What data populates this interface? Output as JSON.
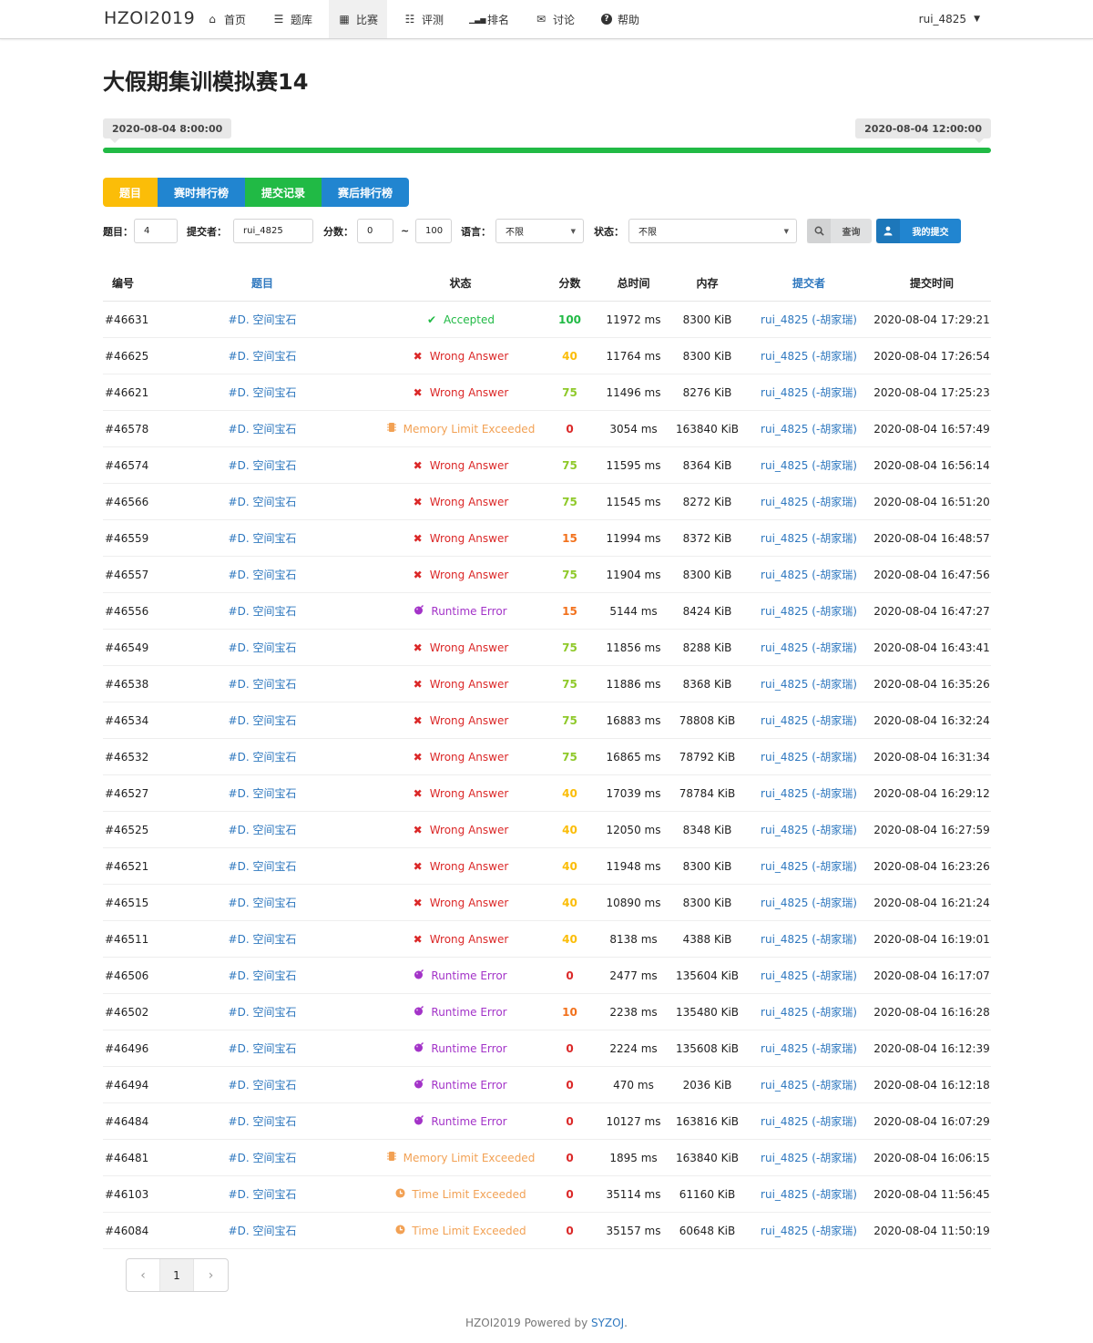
{
  "nav": {
    "brand": "HZOI2019",
    "items": [
      {
        "label": "首页",
        "icon": "home-icon"
      },
      {
        "label": "题库",
        "icon": "list-icon"
      },
      {
        "label": "比赛",
        "icon": "calendar-icon"
      },
      {
        "label": "评测",
        "icon": "tasks-icon"
      },
      {
        "label": "排名",
        "icon": "signal-icon"
      },
      {
        "label": "讨论",
        "icon": "comments-icon"
      },
      {
        "label": "帮助",
        "icon": "help-icon"
      }
    ],
    "active": "比赛",
    "user": "rui_4825"
  },
  "contest": {
    "title": "大假期集训模拟赛14",
    "start": "2020-08-04 8:00:00",
    "end": "2020-08-04 12:00:00",
    "progress": 1.0,
    "progress_color": "#21ba45"
  },
  "tabs": [
    {
      "label": "题目",
      "color": "#fbbd08"
    },
    {
      "label": "赛时排行榜",
      "color": "#2185d0"
    },
    {
      "label": "提交记录",
      "color": "#21ba45"
    },
    {
      "label": "赛后排行榜",
      "color": "#2185d0"
    }
  ],
  "filters": {
    "problem_label": "题目：",
    "problem_value": "4",
    "submitter_label": "提交者：",
    "submitter_value": "rui_4825",
    "score_label": "分数：",
    "score_min": "0",
    "score_sep": "~",
    "score_max": "100",
    "language_label": "语言：",
    "language_value": "不限",
    "status_label": "状态：",
    "status_value": "不限",
    "search_button": "查询",
    "mine_button": "我的提交"
  },
  "table": {
    "headers": [
      "编号",
      "题目",
      "状态",
      "分数",
      "总时间",
      "内存",
      "提交者",
      "提交时间"
    ],
    "rows": [
      {
        "id": "#46631",
        "problem": "#D. 空间宝石",
        "status": "Accepted",
        "score": "100",
        "time": "11972 ms",
        "memory": "8300 KiB",
        "submitter": "rui_4825 (-胡家瑞)",
        "submit_time": "2020-08-04 17:29:21"
      },
      {
        "id": "#46625",
        "problem": "#D. 空间宝石",
        "status": "Wrong Answer",
        "score": "40",
        "time": "11764 ms",
        "memory": "8300 KiB",
        "submitter": "rui_4825 (-胡家瑞)",
        "submit_time": "2020-08-04 17:26:54"
      },
      {
        "id": "#46621",
        "problem": "#D. 空间宝石",
        "status": "Wrong Answer",
        "score": "75",
        "time": "11496 ms",
        "memory": "8276 KiB",
        "submitter": "rui_4825 (-胡家瑞)",
        "submit_time": "2020-08-04 17:25:23"
      },
      {
        "id": "#46578",
        "problem": "#D. 空间宝石",
        "status": "Memory Limit Exceeded",
        "score": "0",
        "time": "3054 ms",
        "memory": "163840 KiB",
        "submitter": "rui_4825 (-胡家瑞)",
        "submit_time": "2020-08-04 16:57:49"
      },
      {
        "id": "#46574",
        "problem": "#D. 空间宝石",
        "status": "Wrong Answer",
        "score": "75",
        "time": "11595 ms",
        "memory": "8364 KiB",
        "submitter": "rui_4825 (-胡家瑞)",
        "submit_time": "2020-08-04 16:56:14"
      },
      {
        "id": "#46566",
        "problem": "#D. 空间宝石",
        "status": "Wrong Answer",
        "score": "75",
        "time": "11545 ms",
        "memory": "8272 KiB",
        "submitter": "rui_4825 (-胡家瑞)",
        "submit_time": "2020-08-04 16:51:20"
      },
      {
        "id": "#46559",
        "problem": "#D. 空间宝石",
        "status": "Wrong Answer",
        "score": "15",
        "time": "11994 ms",
        "memory": "8372 KiB",
        "submitter": "rui_4825 (-胡家瑞)",
        "submit_time": "2020-08-04 16:48:57"
      },
      {
        "id": "#46557",
        "problem": "#D. 空间宝石",
        "status": "Wrong Answer",
        "score": "75",
        "time": "11904 ms",
        "memory": "8300 KiB",
        "submitter": "rui_4825 (-胡家瑞)",
        "submit_time": "2020-08-04 16:47:56"
      },
      {
        "id": "#46556",
        "problem": "#D. 空间宝石",
        "status": "Runtime Error",
        "score": "15",
        "time": "5144 ms",
        "memory": "8424 KiB",
        "submitter": "rui_4825 (-胡家瑞)",
        "submit_time": "2020-08-04 16:47:27"
      },
      {
        "id": "#46549",
        "problem": "#D. 空间宝石",
        "status": "Wrong Answer",
        "score": "75",
        "time": "11856 ms",
        "memory": "8288 KiB",
        "submitter": "rui_4825 (-胡家瑞)",
        "submit_time": "2020-08-04 16:43:41"
      },
      {
        "id": "#46538",
        "problem": "#D. 空间宝石",
        "status": "Wrong Answer",
        "score": "75",
        "time": "11886 ms",
        "memory": "8368 KiB",
        "submitter": "rui_4825 (-胡家瑞)",
        "submit_time": "2020-08-04 16:35:26"
      },
      {
        "id": "#46534",
        "problem": "#D. 空间宝石",
        "status": "Wrong Answer",
        "score": "75",
        "time": "16883 ms",
        "memory": "78808 KiB",
        "submitter": "rui_4825 (-胡家瑞)",
        "submit_time": "2020-08-04 16:32:24"
      },
      {
        "id": "#46532",
        "problem": "#D. 空间宝石",
        "status": "Wrong Answer",
        "score": "75",
        "time": "16865 ms",
        "memory": "78792 KiB",
        "submitter": "rui_4825 (-胡家瑞)",
        "submit_time": "2020-08-04 16:31:34"
      },
      {
        "id": "#46527",
        "problem": "#D. 空间宝石",
        "status": "Wrong Answer",
        "score": "40",
        "time": "17039 ms",
        "memory": "78784 KiB",
        "submitter": "rui_4825 (-胡家瑞)",
        "submit_time": "2020-08-04 16:29:12"
      },
      {
        "id": "#46525",
        "problem": "#D. 空间宝石",
        "status": "Wrong Answer",
        "score": "40",
        "time": "12050 ms",
        "memory": "8348 KiB",
        "submitter": "rui_4825 (-胡家瑞)",
        "submit_time": "2020-08-04 16:27:59"
      },
      {
        "id": "#46521",
        "problem": "#D. 空间宝石",
        "status": "Wrong Answer",
        "score": "40",
        "time": "11948 ms",
        "memory": "8300 KiB",
        "submitter": "rui_4825 (-胡家瑞)",
        "submit_time": "2020-08-04 16:23:26"
      },
      {
        "id": "#46515",
        "problem": "#D. 空间宝石",
        "status": "Wrong Answer",
        "score": "40",
        "time": "10890 ms",
        "memory": "8300 KiB",
        "submitter": "rui_4825 (-胡家瑞)",
        "submit_time": "2020-08-04 16:21:24"
      },
      {
        "id": "#46511",
        "problem": "#D. 空间宝石",
        "status": "Wrong Answer",
        "score": "40",
        "time": "8138 ms",
        "memory": "4388 KiB",
        "submitter": "rui_4825 (-胡家瑞)",
        "submit_time": "2020-08-04 16:19:01"
      },
      {
        "id": "#46506",
        "problem": "#D. 空间宝石",
        "status": "Runtime Error",
        "score": "0",
        "time": "2477 ms",
        "memory": "135604 KiB",
        "submitter": "rui_4825 (-胡家瑞)",
        "submit_time": "2020-08-04 16:17:07"
      },
      {
        "id": "#46502",
        "problem": "#D. 空间宝石",
        "status": "Runtime Error",
        "score": "10",
        "time": "2238 ms",
        "memory": "135480 KiB",
        "submitter": "rui_4825 (-胡家瑞)",
        "submit_time": "2020-08-04 16:16:28"
      },
      {
        "id": "#46496",
        "problem": "#D. 空间宝石",
        "status": "Runtime Error",
        "score": "0",
        "time": "2224 ms",
        "memory": "135608 KiB",
        "submitter": "rui_4825 (-胡家瑞)",
        "submit_time": "2020-08-04 16:12:39"
      },
      {
        "id": "#46494",
        "problem": "#D. 空间宝石",
        "status": "Runtime Error",
        "score": "0",
        "time": "470 ms",
        "memory": "2036 KiB",
        "submitter": "rui_4825 (-胡家瑞)",
        "submit_time": "2020-08-04 16:12:18"
      },
      {
        "id": "#46484",
        "problem": "#D. 空间宝石",
        "status": "Runtime Error",
        "score": "0",
        "time": "10127 ms",
        "memory": "163816 KiB",
        "submitter": "rui_4825 (-胡家瑞)",
        "submit_time": "2020-08-04 16:07:29"
      },
      {
        "id": "#46481",
        "problem": "#D. 空间宝石",
        "status": "Memory Limit Exceeded",
        "score": "0",
        "time": "1895 ms",
        "memory": "163840 KiB",
        "submitter": "rui_4825 (-胡家瑞)",
        "submit_time": "2020-08-04 16:06:15"
      },
      {
        "id": "#46103",
        "problem": "#D. 空间宝石",
        "status": "Time Limit Exceeded",
        "score": "0",
        "time": "35114 ms",
        "memory": "61160 KiB",
        "submitter": "rui_4825 (-胡家瑞)",
        "submit_time": "2020-08-04 11:56:45"
      },
      {
        "id": "#46084",
        "problem": "#D. 空间宝石",
        "status": "Time Limit Exceeded",
        "score": "0",
        "time": "35157 ms",
        "memory": "60648 KiB",
        "submitter": "rui_4825 (-胡家瑞)",
        "submit_time": "2020-08-04 11:50:19"
      }
    ]
  },
  "status_styles": {
    "Accepted": {
      "color": "#21ba45",
      "icon": "check-icon"
    },
    "Wrong Answer": {
      "color": "#db2828",
      "icon": "x-icon"
    },
    "Memory Limit Exceeded": {
      "color": "#f2a154",
      "icon": "microchip-icon"
    },
    "Runtime Error": {
      "color": "#a333c8",
      "icon": "bomb-icon"
    },
    "Time Limit Exceeded": {
      "color": "#f2a154",
      "icon": "clock-icon"
    }
  },
  "score_colors": {
    "100": "#21ba45",
    "75": "#8fc92a",
    "40": "#fbbd08",
    "15": "#f2711c",
    "10": "#f2711c",
    "0": "#db2828"
  },
  "pagination": {
    "prev": "‹",
    "current": "1",
    "next": "›"
  },
  "footer": {
    "text": "HZOI2019 Powered by ",
    "link": "SYZOJ",
    "suffix": "."
  }
}
